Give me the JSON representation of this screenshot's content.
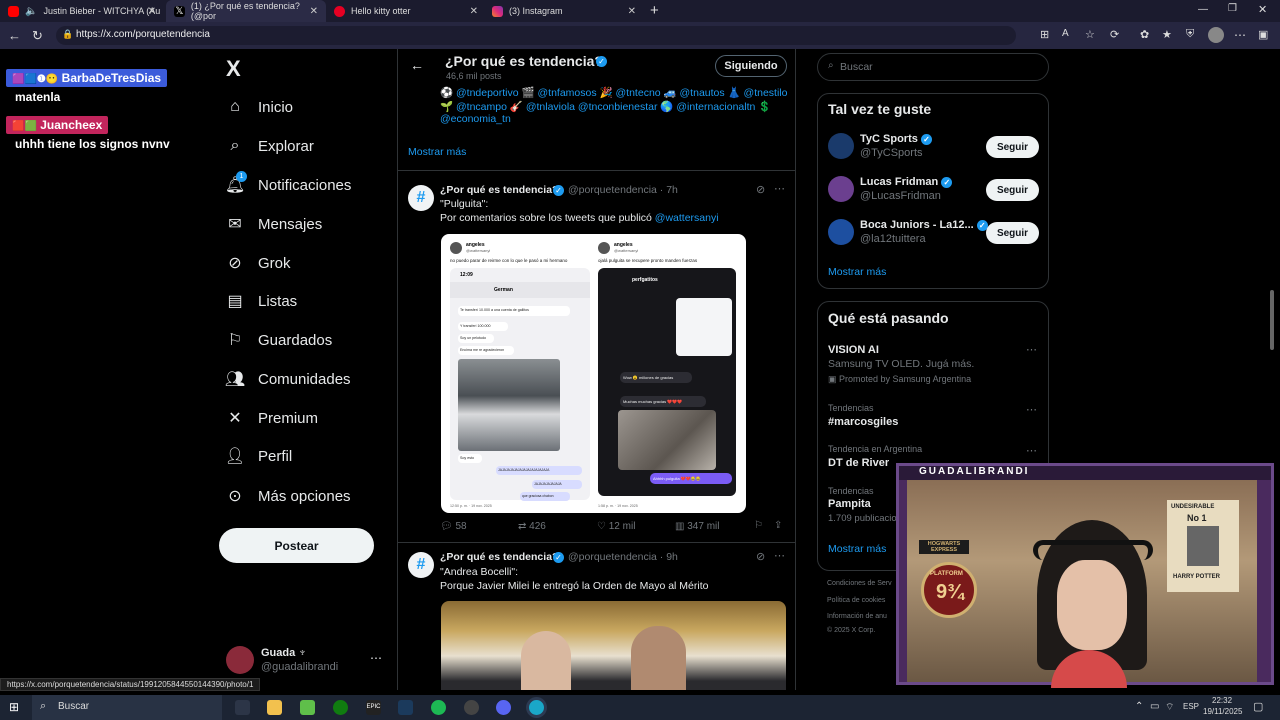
{
  "browser": {
    "tabs": [
      {
        "label": "Justin Bieber - WITCHYA (Au",
        "color": "#ff0000"
      },
      {
        "label": "(1) ¿Por qué es tendencia? (@por",
        "color": "#ffffff"
      },
      {
        "label": "Hello kitty otter",
        "color": "#e60023"
      },
      {
        "label": "(3) Instagram",
        "color": "#d6249f"
      }
    ],
    "url": "https://x.com/porquetendencia",
    "status_url": "https://x.com/porquetendencia/status/1991205844550144390/photo/1"
  },
  "chat": {
    "messages": [
      {
        "user": "BarbaDeTresDias",
        "text": "matenla",
        "color": "#3b5bdb"
      },
      {
        "user": "Juancheex",
        "text": "uhhh tiene los signos nvnv",
        "color": "#c2255c"
      }
    ]
  },
  "nav": {
    "logo": "X",
    "items": [
      {
        "label": "Inicio",
        "icon": "home-icon"
      },
      {
        "label": "Explorar",
        "icon": "search-icon"
      },
      {
        "label": "Notificaciones",
        "icon": "bell-icon"
      },
      {
        "label": "Mensajes",
        "icon": "mail-icon"
      },
      {
        "label": "Grok",
        "icon": "grok-icon"
      },
      {
        "label": "Listas",
        "icon": "list-icon"
      },
      {
        "label": "Guardados",
        "icon": "bookmark-icon"
      },
      {
        "label": "Comunidades",
        "icon": "people-icon"
      },
      {
        "label": "Premium",
        "icon": "x-icon"
      },
      {
        "label": "Perfil",
        "icon": "person-icon"
      },
      {
        "label": "Más opciones",
        "icon": "more-icon"
      }
    ],
    "notif_badge": "1",
    "post_label": "Postear",
    "user_name": "Guada ♆",
    "user_handle": "@guadalibrandi"
  },
  "header": {
    "title": "¿Por qué es tendencia?",
    "posts_count": "46,6 mil posts",
    "follow_label": "Siguiendo"
  },
  "bio": {
    "line1": "⚽ @tndeportivo 🎬 @tnfamosos 🎉 @tntecno 🚙 @tnautos 👗 @tnestilo",
    "line2": "🌱 @tncampo 🎸 @tnlaviola @tnconbienestar 🌎 @internacionaltn 💲",
    "line3": "@economia_tn",
    "show_more": "Mostrar más"
  },
  "tweets": [
    {
      "name": "¿Por qué es tendencia?",
      "handle": "@porquetendencia · 7h",
      "line1": "\"Pulguita\":",
      "line2_prefix": "Por comentarios sobre los tweets que publicó ",
      "line2_link": "@wattersanyi",
      "replies": "58",
      "retweets": "426",
      "likes": "12 mil",
      "views": "347 mil",
      "shot_left": {
        "title": "angeles",
        "handle": "@wattersanyi",
        "text": "no puedo parar de reirme con lo que le pasó a mi hermano",
        "time": "12:09",
        "contact": "German",
        "msg1": "Te transferí 10.000 a una cuenta de gallitos",
        "msg2": "Y transferí 100.000",
        "msg3": "Soy un pelotudo",
        "msg4": "Encima me re agradecieron",
        "msg5": "Soy esto",
        "msg6": "JAJAJAJAJAJAJAJAJAJAJAJAJA",
        "msg7": "JAJAJAJAJAJAJA",
        "msg8": "que graciosa chabon",
        "foot": "12:50 p. m. · 19 nov. 2025"
      },
      "shot_right": {
        "title": "angeles",
        "handle": "@wattersanyi",
        "text": "ojalá pulguita se recupere pronto manden fuerzas",
        "contact": "perfgatitos",
        "msg1": "Wow 😮 millones de gracias",
        "msg2": "Muchas muchas gracias ❤️❤️❤️",
        "msg3": "Ahhhh pulguita ❤️❤️😂😂",
        "foot": "1:58 p. m. · 19 nov. 2025"
      }
    },
    {
      "name": "¿Por qué es tendencia?",
      "handle": "@porquetendencia · 9h",
      "line1": "\"Andrea Bocelli\":",
      "line2": "Porque Javier Milei le entregó la Orden de Mayo al Mérito"
    }
  ],
  "sidebar": {
    "search_placeholder": "Buscar",
    "suggest_title": "Tal vez te guste",
    "suggestions": [
      {
        "name": "TyC Sports",
        "handle": "@TyCSports",
        "color": "#1a3a6b"
      },
      {
        "name": "Lucas Fridman",
        "handle": "@LucasFridman",
        "color": "#6b3f8f"
      },
      {
        "name": "Boca Juniors - La12...",
        "handle": "@la12tuittera",
        "color": "#1d4fa0"
      }
    ],
    "follow_label": "Seguir",
    "show_more": "Mostrar más",
    "whats_title": "Qué está pasando",
    "trends": [
      {
        "label": "",
        "title": "VISION AI",
        "sub": "Samsung TV OLED. Jugá más.",
        "promo": "Promoted by Samsung Argentina"
      },
      {
        "label": "Tendencias",
        "title": "#marcosgiles",
        "sub": ""
      },
      {
        "label": "Tendencia en Argentina",
        "title": "DT de River",
        "sub": ""
      },
      {
        "label": "Tendencias",
        "title": "Pampita",
        "sub": "1.709 publicacio"
      }
    ],
    "trends_more": "Mostrar más",
    "footer": [
      "Condiciones de Serv",
      "Política de cookies",
      "Información de anu",
      "© 2025 X Corp."
    ]
  },
  "webcam": {
    "label": "GUADALIBRANDI",
    "poster1": "UNDESIRABLE",
    "poster2": "No 1",
    "poster3": "HARRY POTTER",
    "sign": "HOGWARTS EXPRESS",
    "platform": "PLATFORM",
    "platform_num": "9¾"
  },
  "taskbar": {
    "search": "Buscar",
    "lang": "ESP",
    "time": "22:32",
    "date": "19/11/2025"
  }
}
